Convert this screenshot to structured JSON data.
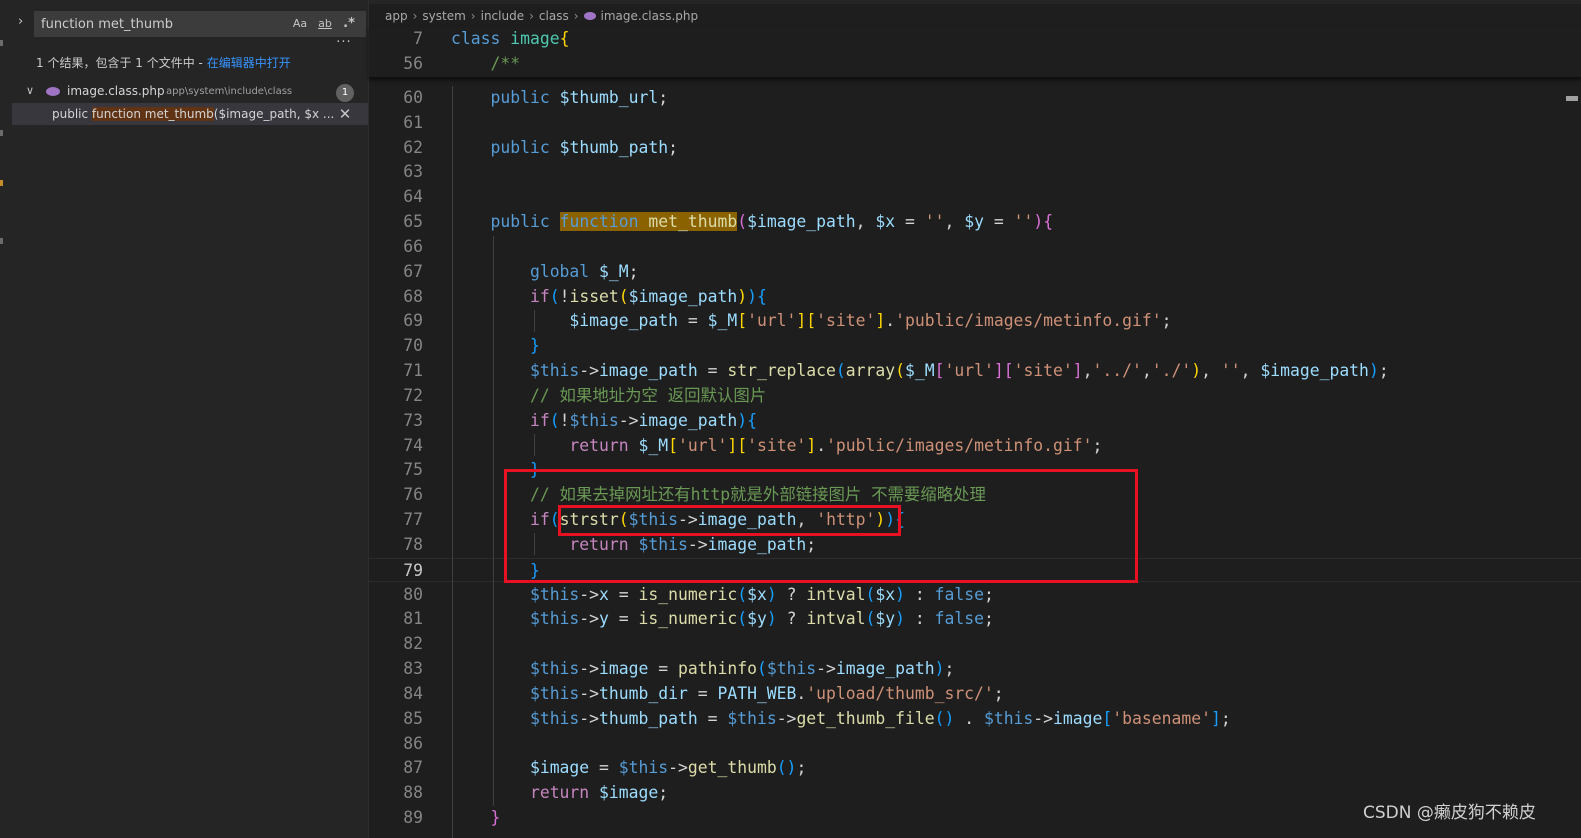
{
  "search": {
    "query": "function met_thumb",
    "toggle_replace_glyph": "›",
    "opt_match_case": "Aa",
    "opt_whole_word": "ab",
    "opt_regex": ".*",
    "more_options": "···",
    "summary_text": "1 个结果，包含于 1 个文件中 - ",
    "open_in_editor": "在编辑器中打开",
    "file": {
      "chevron": "∨",
      "name": "image.class.php",
      "path": "app\\system\\include\\class",
      "count": "1"
    },
    "match": {
      "before": "public ",
      "hit": "function met_thumb",
      "after": "($image_path, $x ...",
      "dismiss": "✕"
    }
  },
  "breadcrumb": {
    "parts": [
      "app",
      "system",
      "include",
      "class",
      "image.class.php"
    ],
    "sep": "›"
  },
  "editor": {
    "current_line": "79",
    "sticky_lines": [
      {
        "n": "7",
        "code": "<span class=\"kw\">class</span> <span class=\"cls\">image</span><span class=\"b1\">{</span>"
      },
      {
        "n": "56",
        "code": "    <span class=\"cm\">/**</span>"
      }
    ],
    "lines": [
      {
        "n": "60",
        "code": "    <span class=\"kw\">public</span> <span class=\"var\">$thumb_url</span>;"
      },
      {
        "n": "61",
        "code": ""
      },
      {
        "n": "62",
        "code": "    <span class=\"kw\">public</span> <span class=\"var\">$thumb_path</span>;"
      },
      {
        "n": "63",
        "code": ""
      },
      {
        "n": "64",
        "code": ""
      },
      {
        "n": "65",
        "code": "    <span class=\"kw\">public</span> <span class=\"hl\"><span class=\"kw\">function</span> <span class=\"fn\">met_thumb</span></span><span class=\"b2\">(</span><span class=\"var\">$image_path</span>, <span class=\"var\">$x</span> = <span class=\"str\">''</span>, <span class=\"var\">$y</span> = <span class=\"str\">''</span><span class=\"b2\">){</span>"
      },
      {
        "n": "66",
        "code": ""
      },
      {
        "n": "67",
        "code": "        <span class=\"kw\">global</span> <span class=\"var\">$_M</span>;"
      },
      {
        "n": "68",
        "code": "        <span class=\"ctl\">if</span><span class=\"b3\">(</span>!<span class=\"fn\">isset</span><span class=\"b1\">(</span><span class=\"var\">$image_path</span><span class=\"b1\">)</span><span class=\"b3\">){</span>"
      },
      {
        "n": "69",
        "code": "            <span class=\"var\">$image_path</span> = <span class=\"var\">$_M</span><span class=\"b1\">[</span><span class=\"str\">'url'</span><span class=\"b1\">][</span><span class=\"str\">'site'</span><span class=\"b1\">]</span>.<span class=\"str\">'public/images/metinfo.gif'</span>;"
      },
      {
        "n": "70",
        "code": "        <span class=\"b3\">}</span>"
      },
      {
        "n": "71",
        "code": "        <span class=\"kw\">$this</span>-><span class=\"var\">image_path</span> = <span class=\"fn\">str_replace</span><span class=\"b3\">(</span><span class=\"fn\">array</span><span class=\"b1\">(</span><span class=\"var\">$_M</span><span class=\"b2\">[</span><span class=\"str\">'url'</span><span class=\"b2\">][</span><span class=\"str\">'site'</span><span class=\"b2\">]</span>,<span class=\"str\">'../'</span>,<span class=\"str\">'./'</span><span class=\"b1\">)</span>, <span class=\"str\">''</span>, <span class=\"var\">$image_path</span><span class=\"b3\">)</span>;"
      },
      {
        "n": "72",
        "code": "        <span class=\"cm\">// 如果地址为空 返回默认图片</span>"
      },
      {
        "n": "73",
        "code": "        <span class=\"ctl\">if</span><span class=\"b3\">(</span>!<span class=\"kw\">$this</span>-><span class=\"var\">image_path</span><span class=\"b3\">){</span>"
      },
      {
        "n": "74",
        "code": "            <span class=\"ctl\">return</span> <span class=\"var\">$_M</span><span class=\"b1\">[</span><span class=\"str\">'url'</span><span class=\"b1\">][</span><span class=\"str\">'site'</span><span class=\"b1\">]</span>.<span class=\"str\">'public/images/metinfo.gif'</span>;"
      },
      {
        "n": "75",
        "code": "        <span class=\"b3\">}</span>"
      },
      {
        "n": "76",
        "code": "        <span class=\"cm\">// 如果去掉网址还有http就是外部链接图片 不需要缩略处理</span>"
      },
      {
        "n": "77",
        "code": "        <span class=\"ctl\">if</span><span class=\"b3\">(</span><span class=\"fn\">strstr</span><span class=\"b1\">(</span><span class=\"kw\">$this</span>-><span class=\"var\">image_path</span>, <span class=\"str\">'http'</span><span class=\"b1\">)</span><span class=\"b3\">){</span>"
      },
      {
        "n": "78",
        "code": "            <span class=\"ctl\">return</span> <span class=\"kw\">$this</span>-><span class=\"var\">image_path</span>;"
      },
      {
        "n": "79",
        "code": "        <span class=\"b3\">}</span>"
      },
      {
        "n": "80",
        "code": "        <span class=\"kw\">$this</span>-><span class=\"var\">x</span> = <span class=\"fn\">is_numeric</span><span class=\"b3\">(</span><span class=\"var\">$x</span><span class=\"b3\">)</span> ? <span class=\"fn\">intval</span><span class=\"b3\">(</span><span class=\"var\">$x</span><span class=\"b3\">)</span> : <span class=\"kw\">false</span>;"
      },
      {
        "n": "81",
        "code": "        <span class=\"kw\">$this</span>-><span class=\"var\">y</span> = <span class=\"fn\">is_numeric</span><span class=\"b3\">(</span><span class=\"var\">$y</span><span class=\"b3\">)</span> ? <span class=\"fn\">intval</span><span class=\"b3\">(</span><span class=\"var\">$y</span><span class=\"b3\">)</span> : <span class=\"kw\">false</span>;"
      },
      {
        "n": "82",
        "code": ""
      },
      {
        "n": "83",
        "code": "        <span class=\"kw\">$this</span>-><span class=\"var\">image</span> = <span class=\"fn\">pathinfo</span><span class=\"b3\">(</span><span class=\"kw\">$this</span>-><span class=\"var\">image_path</span><span class=\"b3\">)</span>;"
      },
      {
        "n": "84",
        "code": "        <span class=\"kw\">$this</span>-><span class=\"var\">thumb_dir</span> = <span class=\"var\">PATH_WEB</span>.<span class=\"str\">'upload/thumb_src/'</span>;"
      },
      {
        "n": "85",
        "code": "        <span class=\"kw\">$this</span>-><span class=\"var\">thumb_path</span> = <span class=\"kw\">$this</span>-><span class=\"fn\">get_thumb_file</span><span class=\"b3\">()</span> . <span class=\"kw\">$this</span>-><span class=\"var\">image</span><span class=\"b3\">[</span><span class=\"str\">'basename'</span><span class=\"b3\">]</span>;"
      },
      {
        "n": "86",
        "code": ""
      },
      {
        "n": "87",
        "code": "        <span class=\"var\">$image</span> = <span class=\"kw\">$this</span>-><span class=\"fn\">get_thumb</span><span class=\"b3\">()</span>;"
      },
      {
        "n": "88",
        "code": "        <span class=\"ctl\">return</span> <span class=\"var\">$image</span>;"
      },
      {
        "n": "89",
        "code": "    <span class=\"b2\">}</span>"
      }
    ]
  },
  "watermark": "CSDN @癞皮狗不赖皮"
}
